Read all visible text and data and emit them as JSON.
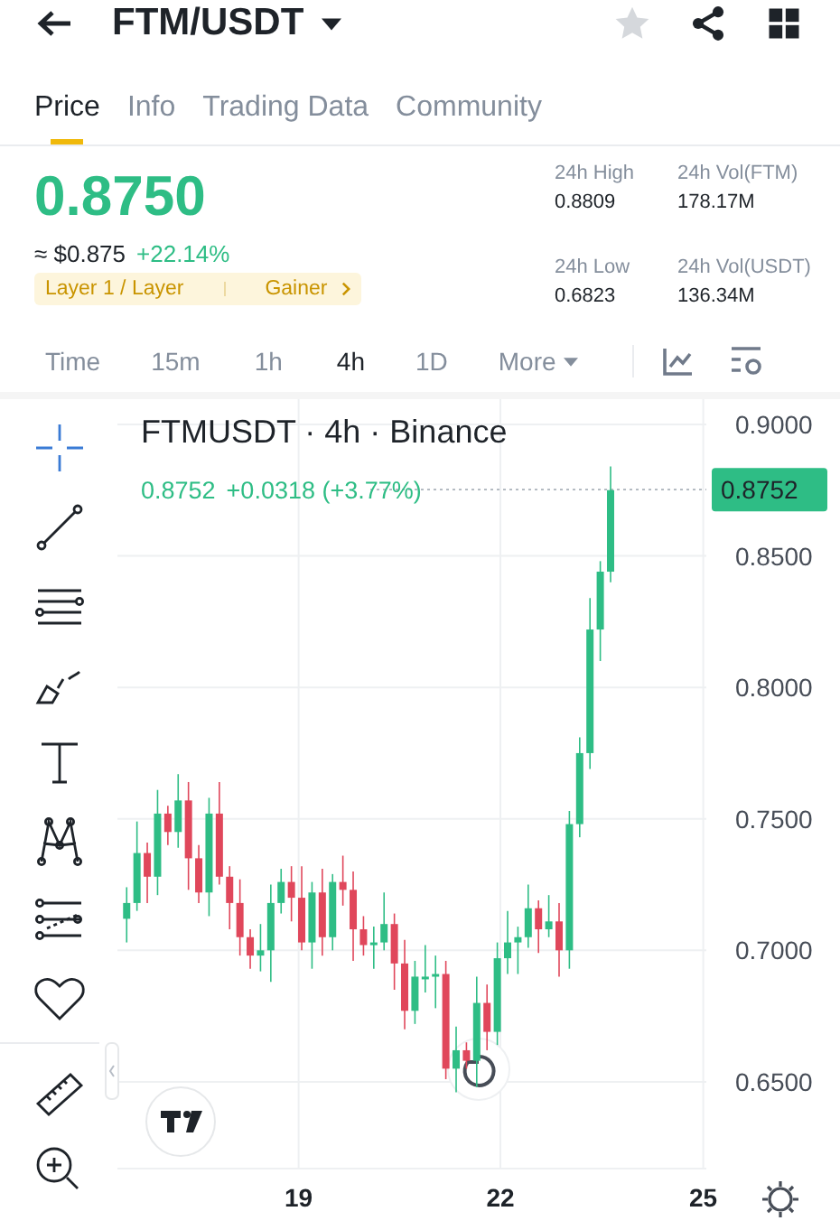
{
  "header": {
    "pair": "FTM/USDT",
    "favorite": false
  },
  "tabs": [
    {
      "label": "Price",
      "selected": true
    },
    {
      "label": "Info",
      "selected": false
    },
    {
      "label": "Trading Data",
      "selected": false
    },
    {
      "label": "Community",
      "selected": false
    }
  ],
  "price": {
    "last": "0.8750",
    "usd": "≈ $0.875",
    "change": "+22.14%",
    "tags": [
      "Layer 1 / Layer",
      "Gainer"
    ]
  },
  "stats": [
    {
      "label": "24h High",
      "value": "0.8809"
    },
    {
      "label": "24h Vol(FTM)",
      "value": "178.17M"
    },
    {
      "label": "24h Low",
      "value": "0.6823"
    },
    {
      "label": "24h Vol(USDT)",
      "value": "136.34M"
    }
  ],
  "intervals": [
    {
      "label": "Time",
      "selected": false
    },
    {
      "label": "15m",
      "selected": false
    },
    {
      "label": "1h",
      "selected": false
    },
    {
      "label": "4h",
      "selected": true
    },
    {
      "label": "1D",
      "selected": false
    },
    {
      "label": "More",
      "selected": false
    }
  ],
  "tools": [
    {
      "kind": "crosshair",
      "selected": true
    },
    {
      "kind": "line",
      "selected": false
    },
    {
      "kind": "parallel",
      "selected": false
    },
    {
      "kind": "brush",
      "selected": false
    },
    {
      "kind": "text",
      "selected": false
    },
    {
      "kind": "pattern",
      "selected": false
    },
    {
      "kind": "fib",
      "selected": false
    },
    {
      "kind": "favorite",
      "selected": false
    },
    {
      "kind": "ruler",
      "selected": false
    },
    {
      "kind": "zoom",
      "selected": false
    }
  ],
  "chart": {
    "title": "FTMUSDT · 4h · Binance",
    "last": "0.8752",
    "change": "+0.0318 (+3.77%)",
    "price_tag": "0.8752",
    "x_labels": [
      "19",
      "22",
      "25"
    ],
    "chart_data": {
      "type": "candlestick",
      "ylim": [
        0.617,
        0.9096
      ],
      "grid": true,
      "yticks": [
        {
          "value": 0.9,
          "label": "0.9000"
        },
        {
          "value": 0.85,
          "label": "0.8500"
        },
        {
          "value": 0.8,
          "label": "0.8000"
        },
        {
          "value": 0.75,
          "label": "0.7500"
        },
        {
          "value": 0.7,
          "label": "0.7000"
        },
        {
          "value": 0.65,
          "label": "0.6500"
        }
      ],
      "ohlc": [
        [
          0.712,
          0.724,
          0.703,
          0.718
        ],
        [
          0.718,
          0.749,
          0.715,
          0.737
        ],
        [
          0.737,
          0.741,
          0.718,
          0.728
        ],
        [
          0.728,
          0.761,
          0.721,
          0.752
        ],
        [
          0.752,
          0.755,
          0.74,
          0.745
        ],
        [
          0.745,
          0.767,
          0.739,
          0.757
        ],
        [
          0.757,
          0.764,
          0.723,
          0.735
        ],
        [
          0.735,
          0.74,
          0.718,
          0.722
        ],
        [
          0.722,
          0.758,
          0.713,
          0.752
        ],
        [
          0.752,
          0.764,
          0.725,
          0.728
        ],
        [
          0.728,
          0.732,
          0.708,
          0.718
        ],
        [
          0.718,
          0.727,
          0.698,
          0.705
        ],
        [
          0.705,
          0.708,
          0.693,
          0.698
        ],
        [
          0.698,
          0.71,
          0.692,
          0.7
        ],
        [
          0.7,
          0.725,
          0.688,
          0.718
        ],
        [
          0.718,
          0.731,
          0.714,
          0.726
        ],
        [
          0.726,
          0.732,
          0.711,
          0.72
        ],
        [
          0.72,
          0.732,
          0.7,
          0.703
        ],
        [
          0.703,
          0.726,
          0.693,
          0.722
        ],
        [
          0.722,
          0.731,
          0.698,
          0.705
        ],
        [
          0.705,
          0.729,
          0.7,
          0.726
        ],
        [
          0.726,
          0.736,
          0.717,
          0.723
        ],
        [
          0.723,
          0.73,
          0.696,
          0.708
        ],
        [
          0.708,
          0.713,
          0.698,
          0.702
        ],
        [
          0.702,
          0.709,
          0.693,
          0.703
        ],
        [
          0.703,
          0.722,
          0.7,
          0.71
        ],
        [
          0.71,
          0.714,
          0.685,
          0.695
        ],
        [
          0.695,
          0.704,
          0.67,
          0.677
        ],
        [
          0.677,
          0.696,
          0.672,
          0.69
        ],
        [
          0.69,
          0.702,
          0.684,
          0.69
        ],
        [
          0.69,
          0.698,
          0.678,
          0.691
        ],
        [
          0.691,
          0.696,
          0.651,
          0.655
        ],
        [
          0.655,
          0.671,
          0.646,
          0.662
        ],
        [
          0.662,
          0.665,
          0.655,
          0.658
        ],
        [
          0.658,
          0.69,
          0.648,
          0.68
        ],
        [
          0.68,
          0.687,
          0.662,
          0.669
        ],
        [
          0.669,
          0.703,
          0.664,
          0.697
        ],
        [
          0.697,
          0.715,
          0.691,
          0.703
        ],
        [
          0.703,
          0.709,
          0.691,
          0.705
        ],
        [
          0.705,
          0.725,
          0.701,
          0.716
        ],
        [
          0.716,
          0.719,
          0.699,
          0.708
        ],
        [
          0.708,
          0.721,
          0.705,
          0.711
        ],
        [
          0.711,
          0.718,
          0.69,
          0.7
        ],
        [
          0.7,
          0.753,
          0.693,
          0.748
        ],
        [
          0.748,
          0.781,
          0.743,
          0.775
        ],
        [
          0.775,
          0.834,
          0.769,
          0.822
        ],
        [
          0.822,
          0.848,
          0.81,
          0.844
        ],
        [
          0.844,
          0.884,
          0.84,
          0.875
        ]
      ]
    }
  }
}
